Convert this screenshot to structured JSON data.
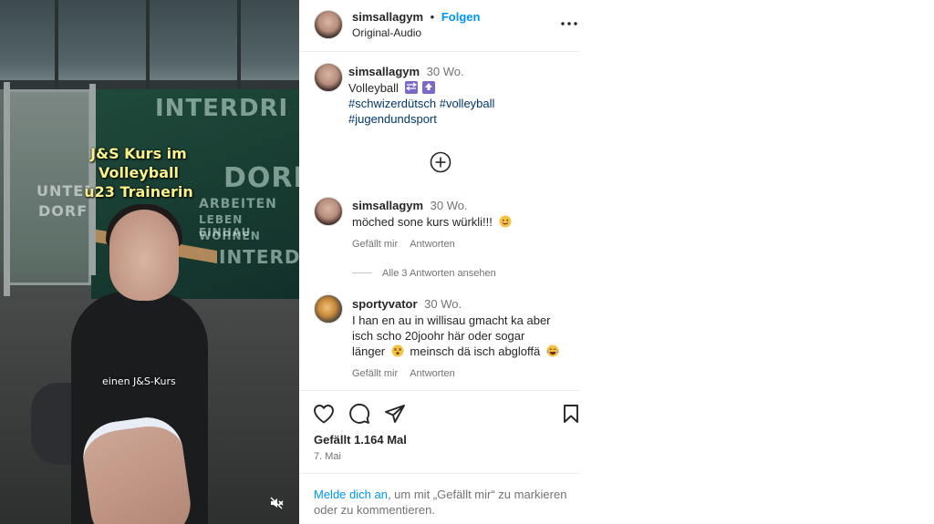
{
  "video": {
    "caption_line1": "J&S Kurs im Volleyball",
    "caption_line2": "u23 Trainerin",
    "subcaption": "einen J&S-Kurs",
    "wall_words": [
      "INTERDRI",
      "DORF",
      "ARBEITEN",
      "LEBEN EINHAU",
      "WOHNEN",
      "INTERDORF",
      "UNTER",
      "DORF"
    ],
    "mute_icon": "speaker-muted-icon"
  },
  "header": {
    "username": "simsallagym",
    "separator": "•",
    "follow_label": "Folgen",
    "audio_label": "Original-Audio",
    "more_icon": "more-dots-icon"
  },
  "post": {
    "username": "simsallagym",
    "age": "30 Wo.",
    "caption": "Volleyball",
    "caption_emojis": [
      "on-arrow-icon",
      "top-arrow-icon"
    ],
    "hashtags_line1": "#schwizerdütsch #volleyball",
    "hashtags_line2": "#jugendundsport",
    "add_icon": "plus-circle-icon"
  },
  "comments": [
    {
      "username": "simsallagym",
      "age": "30 Wo.",
      "text": "möched sone kurs würkli!!!",
      "emoji": "smiling-face-icon",
      "like_label": "Gefällt mir",
      "reply_label": "Antworten",
      "view_replies": "Alle 3 Antworten ansehen"
    },
    {
      "username": "sportyvator",
      "age": "30 Wo.",
      "line1": "I han en au in willisau gmacht ka aber",
      "line2": "isch scho 20joohr här oder sogar",
      "line3_a": "länger",
      "line3_b": "meinsch dä isch abgloffä",
      "emoji1": "dizzy-face-icon",
      "emoji2": "laughing-face-icon",
      "like_label": "Gefällt mir",
      "reply_label": "Antworten"
    }
  ],
  "actions": {
    "like_icon": "heart-icon",
    "comment_icon": "comment-icon",
    "share_icon": "share-icon",
    "save_icon": "bookmark-icon",
    "likes": "Gefällt 1.164 Mal",
    "date": "7. Mai"
  },
  "footer": {
    "login_link": "Melde dich an",
    "text_a": ", um mit „Gefällt mir“ zu markieren",
    "text_b": "oder zu kommentieren."
  },
  "colors": {
    "accent": "#0095f6",
    "hashtag": "#00376b",
    "caption_yellow": "#f7f28c"
  }
}
